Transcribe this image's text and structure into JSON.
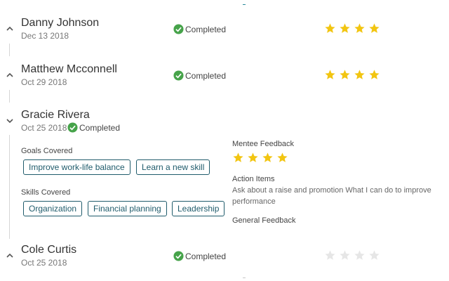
{
  "theme": {
    "star_filled": "#f2c511",
    "star_empty": "#e6e6e6",
    "check_green": "#46a34a",
    "chip_color": "#1f5b6b"
  },
  "sessions": [
    {
      "name": "Danny Johnson",
      "date": "Dec 13 2018",
      "status": "Completed",
      "rating": 4,
      "expanded": false
    },
    {
      "name": "Matthew Mcconnell",
      "date": "Oct 29 2018",
      "status": "Completed",
      "rating": 4,
      "expanded": false
    },
    {
      "name": "Gracie Rivera",
      "date": "Oct 25 2018",
      "status": "Completed",
      "expanded": true,
      "goals_label": "Goals Covered",
      "goals": [
        "Improve work-life balance",
        "Learn a new skill"
      ],
      "skills_label": "Skills Covered",
      "skills": [
        "Organization",
        "Financial planning",
        "Leadership"
      ],
      "feedback_label": "Mentee Feedback",
      "rating": 4,
      "action_items_label": "Action Items",
      "action_items_text": "Ask about a raise and promotion What I can do to improve performance",
      "general_feedback_label": "General Feedback"
    },
    {
      "name": "Cole Curtis",
      "date": "Oct 25 2018",
      "status": "Completed",
      "rating": 0,
      "expanded": false
    }
  ]
}
